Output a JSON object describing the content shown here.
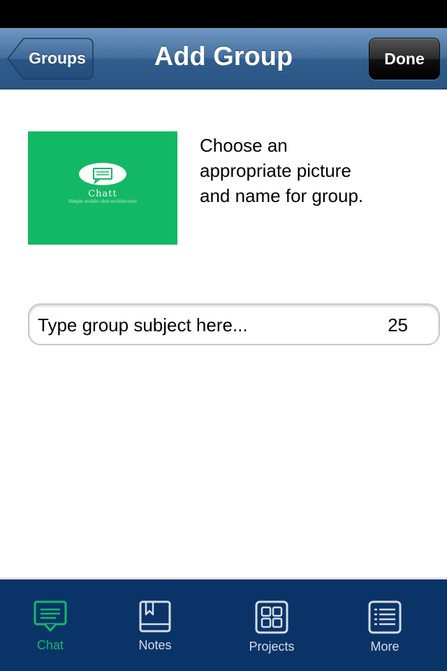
{
  "nav": {
    "title": "Add Group",
    "back_label": "Groups",
    "done_label": "Done"
  },
  "group_picture": {
    "logo_name": "Chatt",
    "logo_tagline": "Simple mobile chat architecture",
    "background_color": "#13b864"
  },
  "instruction_text": "Choose an appropriate picture and name for group.",
  "subject_field": {
    "placeholder": "Type group subject here...",
    "value": "",
    "remaining_chars": "25"
  },
  "tab_bar": {
    "active_color": "#14b86a",
    "background_color": "#0a3468",
    "tabs": [
      {
        "label": "Chat",
        "icon": "chat-bubble-icon",
        "active": true
      },
      {
        "label": "Notes",
        "icon": "bookmark-book-icon",
        "active": false
      },
      {
        "label": "Projects",
        "icon": "grid-icon",
        "active": false
      },
      {
        "label": "More",
        "icon": "list-icon",
        "active": false
      }
    ]
  }
}
